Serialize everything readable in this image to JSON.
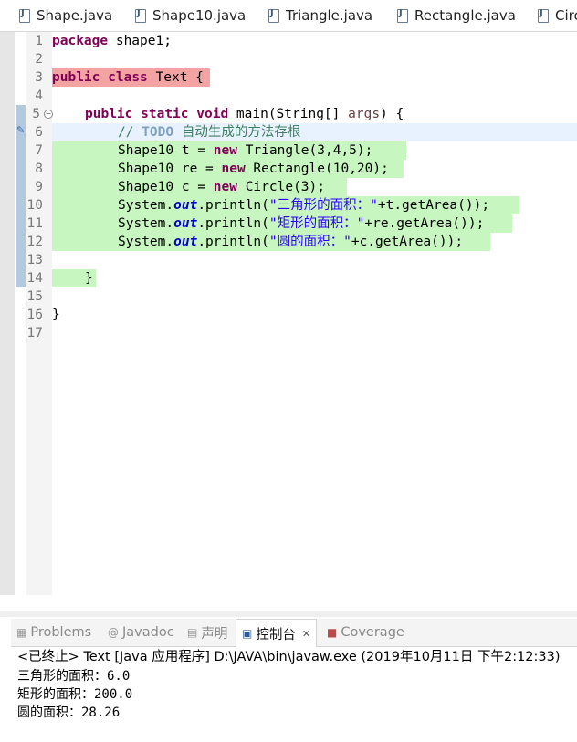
{
  "editor_tabs": [
    {
      "label": "Shape.java",
      "icon": "java-file-icon"
    },
    {
      "label": "Shape10.java",
      "icon": "java-file-icon"
    },
    {
      "label": "Triangle.java",
      "icon": "java-file-icon"
    },
    {
      "label": "Rectangle.java",
      "icon": "java-file-icon"
    },
    {
      "label": "Circ",
      "icon": "java-file-icon"
    }
  ],
  "line_numbers": [
    "1",
    "2",
    "3",
    "4",
    "5",
    "6",
    "7",
    "8",
    "9",
    "10",
    "11",
    "12",
    "13",
    "14",
    "15",
    "16",
    "17"
  ],
  "code": {
    "l1_kw": "package",
    "l1_rest": " shape1;",
    "l3_kw1": "public",
    "l3_kw2": "class",
    "l3_rest": " Text {",
    "l5_kw1": "public",
    "l5_kw2": "static",
    "l5_kw3": "void",
    "l5_a": " main(String[] ",
    "l5_var": "args",
    "l5_b": ") {",
    "l6_cmt1": "// ",
    "l6_todo": "TODO",
    "l6_cmt2": " 自动生成的方法存根",
    "l7_a": "Shape10 t = ",
    "l7_kw": "new",
    "l7_b": " Triangle(3,4,5);",
    "l8_a": "Shape10 re = ",
    "l8_kw": "new",
    "l8_b": " Rectangle(10,20);",
    "l9_a": "Shape10 c = ",
    "l9_kw": "new",
    "l9_b": " Circle(3);",
    "l10_a": "System.",
    "l10_fld": "out",
    "l10_b": ".println(",
    "l10_str": "\"三角形的面积：\"",
    "l10_c": "+t.getArea());",
    "l11_a": "System.",
    "l11_fld": "out",
    "l11_b": ".println(",
    "l11_str": "\"矩形的面积：\"",
    "l11_c": "+re.getArea());",
    "l12_a": "System.",
    "l12_fld": "out",
    "l12_b": ".println(",
    "l12_str": "\"圆的面积：\"",
    "l12_c": "+c.getArea());",
    "l14": "}",
    "l16": "}"
  },
  "panel_tabs": {
    "problems": "Problems",
    "javadoc": "Javadoc",
    "declaration": "声明",
    "console": "控制台",
    "coverage": "Coverage"
  },
  "console": {
    "header": "<已终止> Text [Java 应用程序] D:\\JAVA\\bin\\javaw.exe  (2019年10月11日 下午2:12:33)",
    "output": [
      "三角形的面积：6.0",
      "矩形的面积：200.0",
      "圆的面积：28.26"
    ]
  },
  "colors": {
    "keyword": "#7f0055",
    "string": "#2a00ff",
    "field": "#0000c0",
    "comment": "#3f7f5f",
    "changed_line_bg": "#c8f6c0",
    "error_line_bg": "#f4a3a3"
  }
}
